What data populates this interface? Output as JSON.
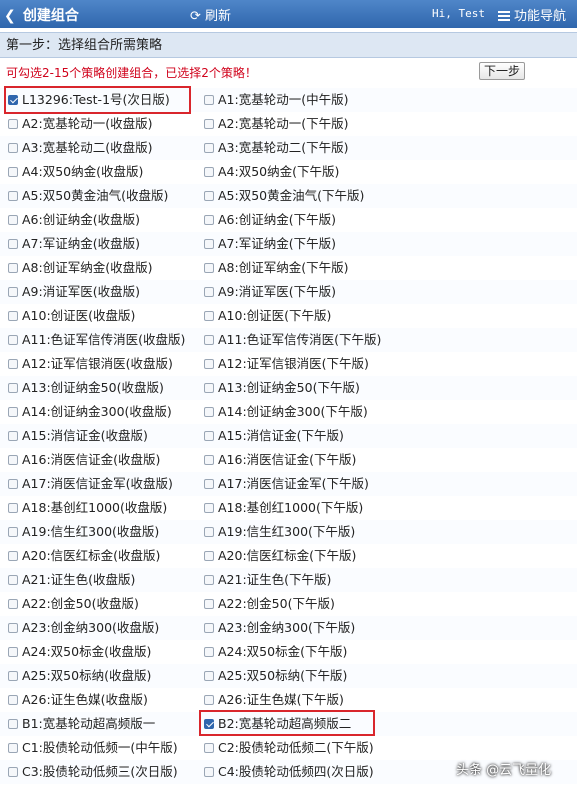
{
  "header": {
    "back_label": "创建组合",
    "refresh_label": "刷新",
    "greeting": "Hi, Test",
    "nav_label": "功能导航"
  },
  "step": {
    "title": "第一步：选择组合所需策略"
  },
  "hint": "可勾选2-15个策略创建组合，已选择2个策略！",
  "next_button": "下一步",
  "rows": [
    [
      {
        "label": "L13296:Test-1号(次日版)",
        "checked": true
      },
      {
        "label": "A1:宽基轮动一(中午版)",
        "checked": false
      }
    ],
    [
      {
        "label": "A2:宽基轮动一(收盘版)",
        "checked": false
      },
      {
        "label": "A2:宽基轮动一(下午版)",
        "checked": false
      }
    ],
    [
      {
        "label": "A3:宽基轮动二(收盘版)",
        "checked": false
      },
      {
        "label": "A3:宽基轮动二(下午版)",
        "checked": false
      }
    ],
    [
      {
        "label": "A4:双50纳金(收盘版)",
        "checked": false
      },
      {
        "label": "A4:双50纳金(下午版)",
        "checked": false
      }
    ],
    [
      {
        "label": "A5:双50黄金油气(收盘版)",
        "checked": false
      },
      {
        "label": "A5:双50黄金油气(下午版)",
        "checked": false
      }
    ],
    [
      {
        "label": "A6:创证纳金(收盘版)",
        "checked": false
      },
      {
        "label": "A6:创证纳金(下午版)",
        "checked": false
      }
    ],
    [
      {
        "label": "A7:军证纳金(收盘版)",
        "checked": false
      },
      {
        "label": "A7:军证纳金(下午版)",
        "checked": false
      }
    ],
    [
      {
        "label": "A8:创证军纳金(收盘版)",
        "checked": false
      },
      {
        "label": "A8:创证军纳金(下午版)",
        "checked": false
      }
    ],
    [
      {
        "label": "A9:消证军医(收盘版)",
        "checked": false
      },
      {
        "label": "A9:消证军医(下午版)",
        "checked": false
      }
    ],
    [
      {
        "label": "A10:创证医(收盘版)",
        "checked": false
      },
      {
        "label": "A10:创证医(下午版)",
        "checked": false
      }
    ],
    [
      {
        "label": "A11:色证军信传消医(收盘版)",
        "checked": false
      },
      {
        "label": "A11:色证军信传消医(下午版)",
        "checked": false
      }
    ],
    [
      {
        "label": "A12:证军信银消医(收盘版)",
        "checked": false
      },
      {
        "label": "A12:证军信银消医(下午版)",
        "checked": false
      }
    ],
    [
      {
        "label": "A13:创证纳金50(收盘版)",
        "checked": false
      },
      {
        "label": "A13:创证纳金50(下午版)",
        "checked": false
      }
    ],
    [
      {
        "label": "A14:创证纳金300(收盘版)",
        "checked": false
      },
      {
        "label": "A14:创证纳金300(下午版)",
        "checked": false
      }
    ],
    [
      {
        "label": "A15:消信证金(收盘版)",
        "checked": false
      },
      {
        "label": "A15:消信证金(下午版)",
        "checked": false
      }
    ],
    [
      {
        "label": "A16:消医信证金(收盘版)",
        "checked": false
      },
      {
        "label": "A16:消医信证金(下午版)",
        "checked": false
      }
    ],
    [
      {
        "label": "A17:消医信证金军(收盘版)",
        "checked": false
      },
      {
        "label": "A17:消医信证金军(下午版)",
        "checked": false
      }
    ],
    [
      {
        "label": "A18:基创红1000(收盘版)",
        "checked": false
      },
      {
        "label": "A18:基创红1000(下午版)",
        "checked": false
      }
    ],
    [
      {
        "label": "A19:信生红300(收盘版)",
        "checked": false
      },
      {
        "label": "A19:信生红300(下午版)",
        "checked": false
      }
    ],
    [
      {
        "label": "A20:信医红标金(收盘版)",
        "checked": false
      },
      {
        "label": "A20:信医红标金(下午版)",
        "checked": false
      }
    ],
    [
      {
        "label": "A21:证生色(收盘版)",
        "checked": false
      },
      {
        "label": "A21:证生色(下午版)",
        "checked": false
      }
    ],
    [
      {
        "label": "A22:创金50(收盘版)",
        "checked": false
      },
      {
        "label": "A22:创金50(下午版)",
        "checked": false
      }
    ],
    [
      {
        "label": "A23:创金纳300(收盘版)",
        "checked": false
      },
      {
        "label": "A23:创金纳300(下午版)",
        "checked": false
      }
    ],
    [
      {
        "label": "A24:双50标金(收盘版)",
        "checked": false
      },
      {
        "label": "A24:双50标金(下午版)",
        "checked": false
      }
    ],
    [
      {
        "label": "A25:双50标纳(收盘版)",
        "checked": false
      },
      {
        "label": "A25:双50标纳(下午版)",
        "checked": false
      }
    ],
    [
      {
        "label": "A26:证生色媒(收盘版)",
        "checked": false
      },
      {
        "label": "A26:证生色媒(下午版)",
        "checked": false
      }
    ],
    [
      {
        "label": "B1:宽基轮动超高频版一",
        "checked": false
      },
      {
        "label": "B2:宽基轮动超高频版二",
        "checked": true
      }
    ],
    [
      {
        "label": "C1:股债轮动低频一(中午版)",
        "checked": false
      },
      {
        "label": "C2:股债轮动低频二(下午版)",
        "checked": false
      }
    ],
    [
      {
        "label": "C3:股债轮动低频三(次日版)",
        "checked": false
      },
      {
        "label": "C4:股债轮动低频四(次日版)",
        "checked": false
      }
    ]
  ],
  "watermark": "头条 @云飞量化",
  "colors": {
    "header": "#2f66ad",
    "hint": "#d0021b",
    "highlight": "#d9262c"
  }
}
